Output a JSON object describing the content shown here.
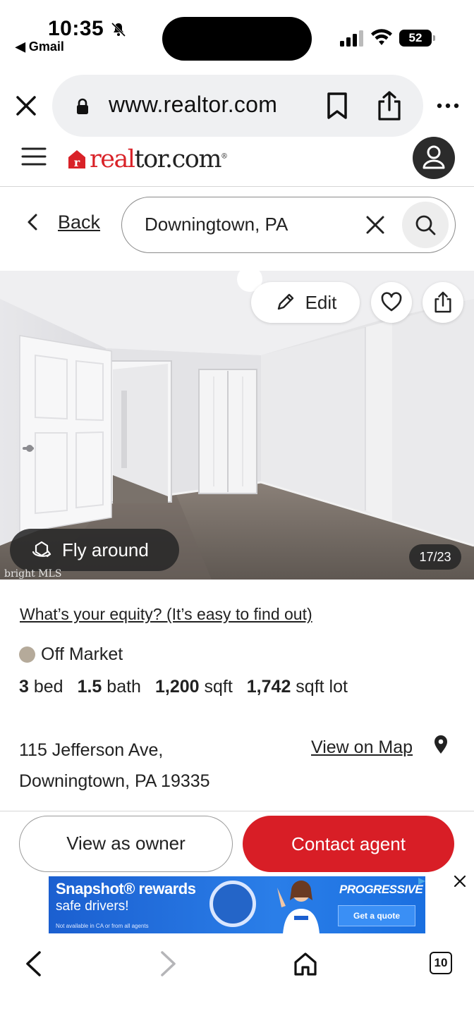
{
  "status_bar": {
    "time": "10:35",
    "back_app": "◀ Gmail",
    "battery": "52"
  },
  "browser": {
    "url": "www.realtor.com",
    "tab_count": "10"
  },
  "header": {
    "logo_red": "real",
    "logo_dark": "tor.com",
    "logo_mark": "®"
  },
  "search": {
    "back_label": "Back",
    "query": "Downingtown, PA"
  },
  "photo": {
    "edit_label": "Edit",
    "fly_around_label": "Fly around",
    "counter": "17/23",
    "mls_mark": "bright MLS"
  },
  "listing": {
    "equity_link": "What’s your equity? (It’s easy to find out)",
    "status": "Off Market",
    "status_color": "#b5aa9a",
    "beds_value": "3",
    "beds_unit": "bed",
    "baths_value": "1.5",
    "baths_unit": "bath",
    "sqft_value": "1,200",
    "sqft_unit": "sqft",
    "lot_value": "1,742",
    "lot_unit": "sqft lot",
    "address_line1": "115 Jefferson Ave,",
    "address_line2": "Downingtown, PA 19335",
    "map_link": "View on Map"
  },
  "actions": {
    "owner_label": "View as owner",
    "contact_label": "Contact agent",
    "contact_color": "#d81e26"
  },
  "ad": {
    "headline": "Snapshot® rewards",
    "subline": "safe drivers!",
    "fine_print": "Not available in CA or from all agents",
    "brand": "PROGRESSIVE",
    "cta": "Get a quote"
  }
}
